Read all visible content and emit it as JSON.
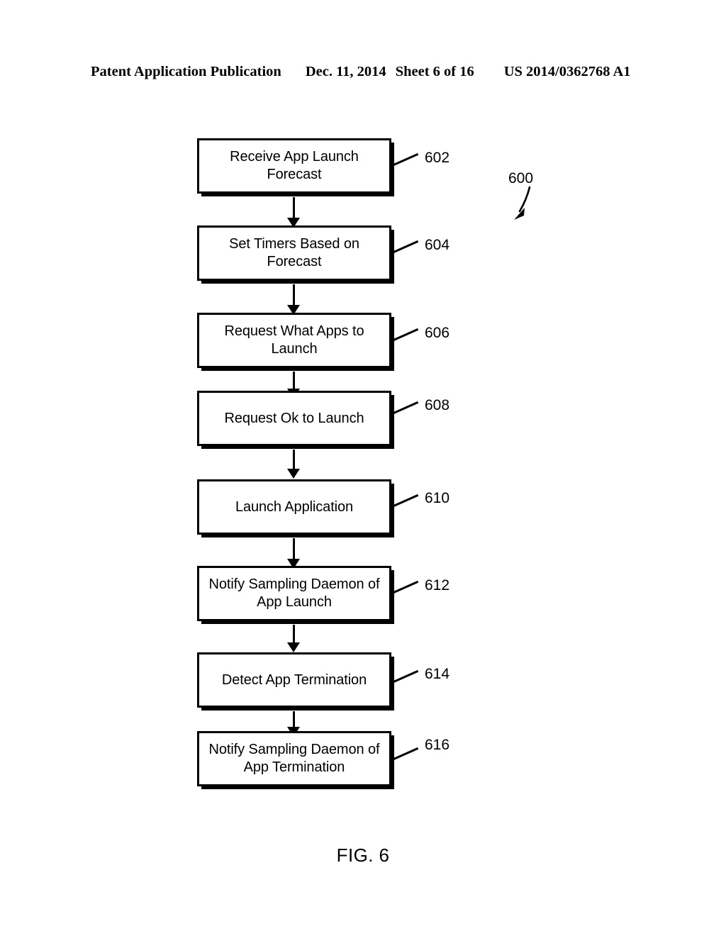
{
  "header": {
    "publication": "Patent Application Publication",
    "date": "Dec. 11, 2014",
    "sheet": "Sheet 6 of 16",
    "patent_number": "US 2014/0362768 A1"
  },
  "figure": {
    "caption": "FIG. 6",
    "diagram_ref": "600",
    "type": "flowchart",
    "colors": {
      "ink": "#000000",
      "background": "#ffffff"
    },
    "nodes": [
      {
        "ref": "602",
        "label": "Receive App Launch\nForecast"
      },
      {
        "ref": "604",
        "label": "Set Timers Based on\nForecast"
      },
      {
        "ref": "606",
        "label": "Request What Apps to\nLaunch"
      },
      {
        "ref": "608",
        "label": "Request Ok to Launch"
      },
      {
        "ref": "610",
        "label": "Launch Application"
      },
      {
        "ref": "612",
        "label": "Notify Sampling Daemon of\nApp Launch"
      },
      {
        "ref": "614",
        "label": "Detect App Termination"
      },
      {
        "ref": "616",
        "label": "Notify Sampling Daemon of\nApp Termination"
      }
    ]
  }
}
